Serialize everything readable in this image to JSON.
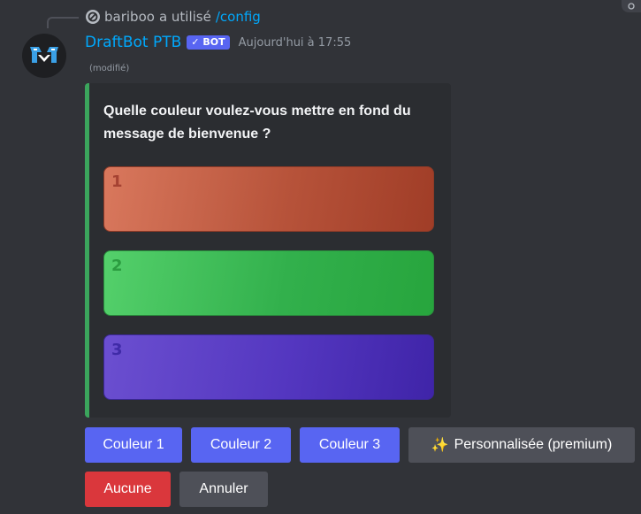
{
  "reply": {
    "username": "bariboo",
    "action": "a utilisé",
    "command": "/config"
  },
  "message": {
    "author": "DraftBot PTB",
    "bot_tag": "✓ BOT",
    "timestamp": "Aujourd'hui à 17:55",
    "edited": "(modifié)"
  },
  "embed": {
    "accent_color": "#3ba55c",
    "title": "Quelle couleur voulez-vous mettre en fond du message de bienvenue ?",
    "swatches": [
      {
        "number": "1",
        "color": "#c15c41"
      },
      {
        "number": "2",
        "color": "#3cbf55"
      },
      {
        "number": "3",
        "color": "#5236bf"
      }
    ]
  },
  "buttons": {
    "color1": "Couleur 1",
    "color2": "Couleur 2",
    "color3": "Couleur 3",
    "custom_emoji": "✨",
    "custom": "Personnalisée (premium)",
    "none": "Aucune",
    "cancel": "Annuler"
  }
}
